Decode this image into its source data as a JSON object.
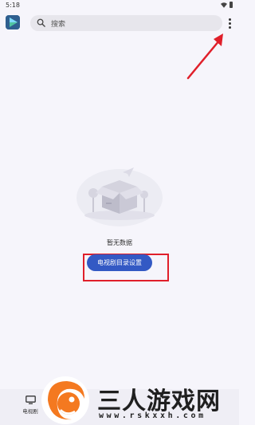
{
  "status_bar": {
    "time": "5:18",
    "wifi_icon": "wifi-icon",
    "battery_icon": "battery-icon"
  },
  "top_bar": {
    "logo_icon": "play-logo-icon",
    "search": {
      "placeholder": "搜索",
      "icon": "search-icon"
    },
    "more_icon": "more-vertical-icon"
  },
  "annotations": {
    "arrow_color": "#e01f2a",
    "box_color": "#e01f2a"
  },
  "empty_state": {
    "illustration": "empty-box-illustration",
    "text": "暂无数据",
    "button_label": "电视剧目录设置"
  },
  "bottom_nav": {
    "tabs": [
      {
        "label": "电视剧",
        "icon": "tv-icon"
      }
    ]
  },
  "watermark": {
    "title": "三人游戏网",
    "url": "www.rskxxh.com",
    "accent_color": "#f47920"
  },
  "colors": {
    "primary_button": "#3359c4",
    "background": "#f6f5fb"
  }
}
